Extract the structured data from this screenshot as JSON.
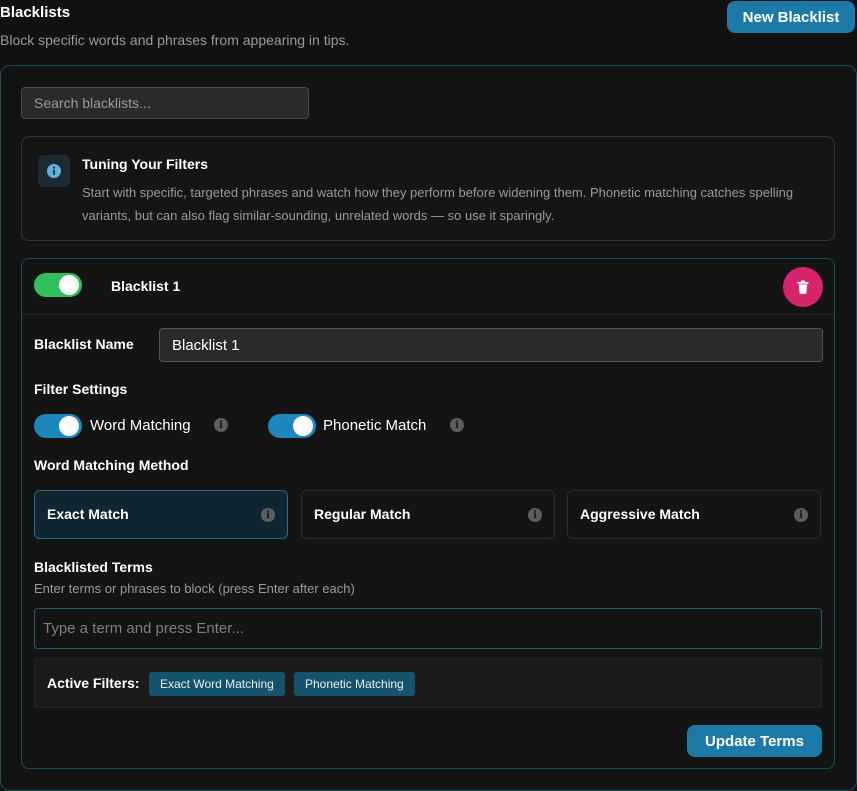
{
  "header": {
    "title": "Blacklists",
    "subtitle": "Block specific words and phrases from appearing in tips.",
    "new_button": "New Blacklist"
  },
  "search": {
    "placeholder": "Search blacklists..."
  },
  "info": {
    "icon": "info-icon",
    "title": "Tuning Your Filters",
    "text": "Start with specific, targeted phrases and watch how they perform before widening them. Phonetic matching catches spelling variants, but can also flag similar-sounding, unrelated words — so use it sparingly."
  },
  "blacklist": {
    "enabled": true,
    "title": "Blacklist 1",
    "name_label": "Blacklist Name",
    "name_value": "Blacklist 1",
    "filter_settings_label": "Filter Settings",
    "toggles": [
      {
        "label": "Word Matching",
        "on": true
      },
      {
        "label": "Phonetic Match",
        "on": true
      }
    ],
    "method_label": "Word Matching Method",
    "methods": [
      {
        "label": "Exact Match",
        "active": true
      },
      {
        "label": "Regular Match",
        "active": false
      },
      {
        "label": "Aggressive Match",
        "active": false
      }
    ],
    "terms_label": "Blacklisted Terms",
    "terms_hint": "Enter terms or phrases to block (press Enter after each)",
    "terms_placeholder": "Type a term and press Enter...",
    "active_filters_label": "Active Filters:",
    "active_filters": [
      "Exact Word Matching",
      "Phonetic Matching"
    ],
    "update_button": "Update Terms"
  },
  "colors": {
    "accent": "#1d7aa8",
    "toggle_green": "#2fbf5b",
    "delete": "#d6246e",
    "chip": "#15526b"
  }
}
